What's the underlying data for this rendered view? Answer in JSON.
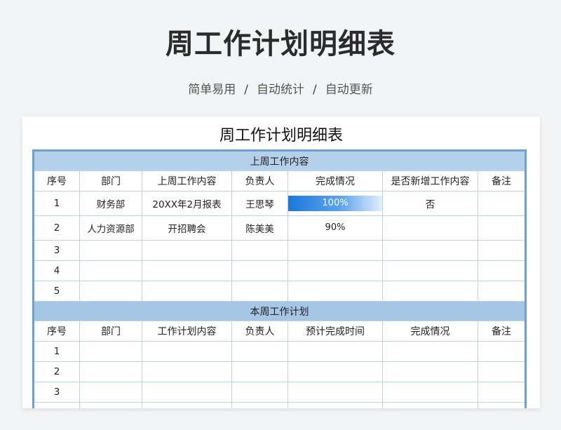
{
  "hero": {
    "title": "周工作计划明细表",
    "tags": [
      "简单易用",
      "自动统计",
      "自动更新"
    ],
    "separator": "/"
  },
  "sheet": {
    "title": "周工作计划明细表",
    "last_week": {
      "section_label": "上周工作内容",
      "headers": [
        "序号",
        "部门",
        "上周工作内容",
        "负责人",
        "完成情况",
        "是否新增工作内容",
        "备注"
      ],
      "rows": [
        {
          "no": "1",
          "dept": "财务部",
          "content": "20XX年2月报表",
          "owner": "王思琴",
          "progress_text": "100%",
          "progress": 1.0,
          "is_new": "否",
          "note": ""
        },
        {
          "no": "2",
          "dept": "人力资源部",
          "content": "开招聘会",
          "owner": "陈美美",
          "progress_text": "90%",
          "progress": 0.9,
          "is_new": "",
          "note": ""
        },
        {
          "no": "3",
          "dept": "",
          "content": "",
          "owner": "",
          "progress_text": "",
          "is_new": "",
          "note": ""
        },
        {
          "no": "4",
          "dept": "",
          "content": "",
          "owner": "",
          "progress_text": "",
          "is_new": "",
          "note": ""
        },
        {
          "no": "5",
          "dept": "",
          "content": "",
          "owner": "",
          "progress_text": "",
          "is_new": "",
          "note": ""
        }
      ]
    },
    "this_week": {
      "section_label": "本周工作计划",
      "headers": [
        "序号",
        "部门",
        "工作计划内容",
        "负责人",
        "预计完成时间",
        "完成情况",
        "备注"
      ],
      "rows": [
        {
          "no": "1"
        },
        {
          "no": "2"
        },
        {
          "no": "3"
        }
      ]
    }
  },
  "colors": {
    "section_bg": "#b4d0ea",
    "frame": "#6e9fd1",
    "progress_start": "#1b78dc",
    "progress_end": "#e3effb"
  }
}
